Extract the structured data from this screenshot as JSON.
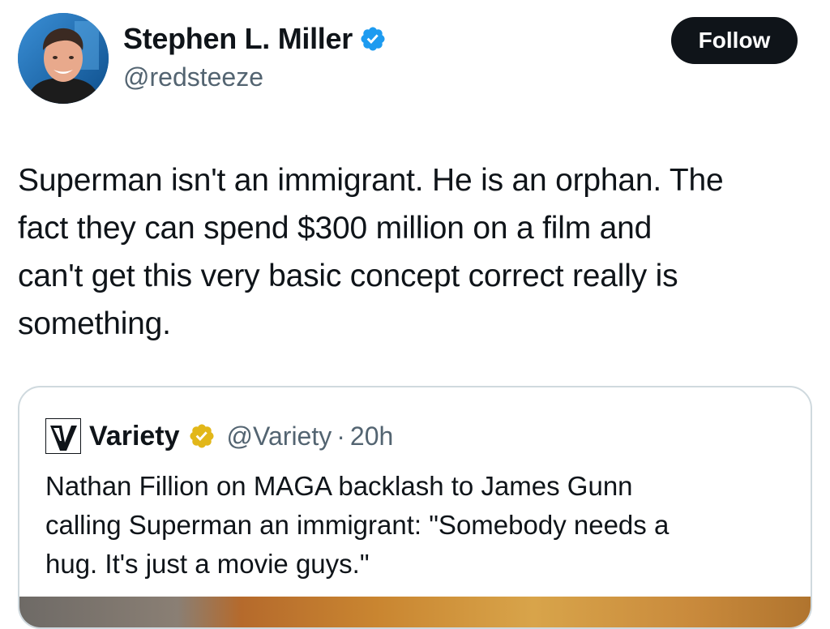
{
  "author": {
    "display_name": "Stephen L. Miller",
    "handle": "@redsteeze",
    "avatar_icon": "profile-photo",
    "verified_icon": "blue-verified-badge",
    "verified_color": "#1d9bf0"
  },
  "follow": {
    "label": "Follow",
    "background": "#0f1419"
  },
  "tweet": {
    "text": "Superman isn't an immigrant. He is an orphan. The\nfact they can spend $300 million on a film and\ncan't get this very basic concept correct really is\nsomething."
  },
  "quote": {
    "logo_icon": "variety-v-logo",
    "name": "Variety",
    "verified_icon": "gold-verified-badge",
    "verified_color": "#e2b719",
    "handle": "@Variety",
    "separator": "·",
    "time": "20h",
    "text": "Nathan Fillion on MAGA backlash to James Gunn\ncalling Superman an immigrant: \"Somebody needs a\nhug. It's just a movie guys.\""
  },
  "colors": {
    "text": "#0f1419",
    "secondary_text": "#536471",
    "border": "#cfd9de"
  }
}
